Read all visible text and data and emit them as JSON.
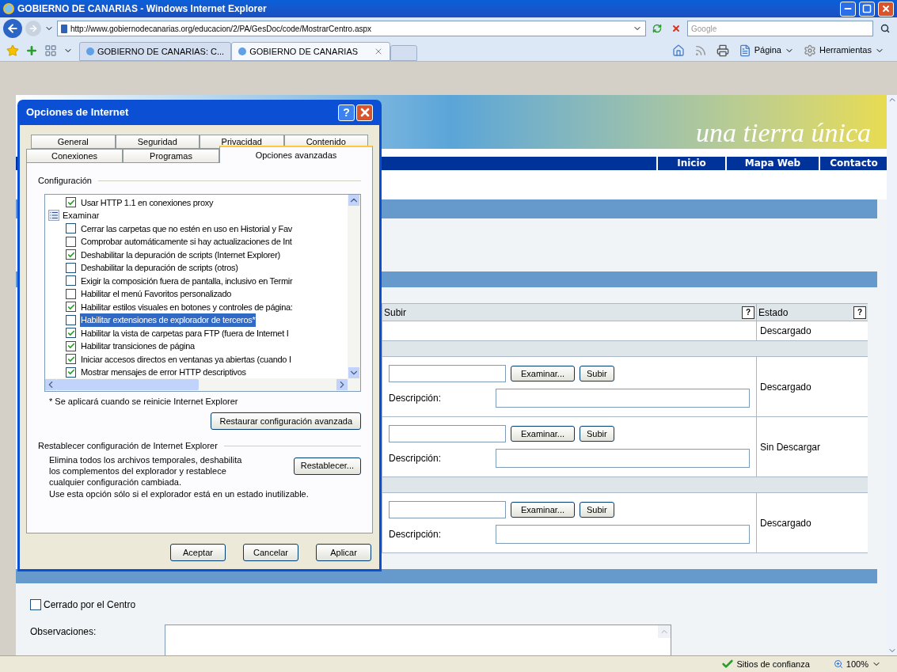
{
  "browser": {
    "title": "GOBIERNO DE CANARIAS - Windows Internet Explorer",
    "address": "http://www.gobiernodecanarias.org/educacion/2/PA/GesDoc/code/MostrarCentro.aspx",
    "search_placeholder": "Google",
    "tabs": [
      {
        "label": "GOBIERNO DE CANARIAS: C...",
        "selected": false
      },
      {
        "label": "GOBIERNO DE CANARIAS",
        "selected": true
      }
    ],
    "commands": [
      "Página",
      "Herramientas"
    ]
  },
  "page": {
    "banner_text": "una tierra única",
    "nav": [
      "Inicio",
      "Mapa Web",
      "Contacto"
    ],
    "table": {
      "columns": [
        {
          "label": "Subir",
          "help": "?"
        },
        {
          "label": "Estado",
          "help": "?"
        }
      ],
      "rows": [
        {
          "kind": "status",
          "estado": "Descargado"
        },
        {
          "kind": "separator"
        },
        {
          "kind": "upload",
          "browse": "Examinar...",
          "upload": "Subir",
          "description_label": "Descripción:",
          "estado": "Descargado"
        },
        {
          "kind": "upload",
          "browse": "Examinar...",
          "upload": "Subir",
          "description_label": "Descripción:",
          "estado": "Sin Descargar"
        },
        {
          "kind": "separator"
        },
        {
          "kind": "upload",
          "browse": "Examinar...",
          "upload": "Subir",
          "description_label": "Descripción:",
          "estado": "Descargado"
        }
      ]
    },
    "closed": {
      "label": "Cerrado por el Centro",
      "checked": false
    },
    "observations_label": "Observaciones:"
  },
  "dialog": {
    "title": "Opciones de Internet",
    "help": "?",
    "tab_rows": [
      [
        {
          "label": "General",
          "selected": false
        },
        {
          "label": "Seguridad",
          "selected": false
        },
        {
          "label": "Privacidad",
          "selected": false
        },
        {
          "label": "Contenido",
          "selected": false
        }
      ],
      [
        {
          "label": "Conexiones",
          "selected": false
        },
        {
          "label": "Programas",
          "selected": false
        },
        {
          "label": "Opciones avanzadas",
          "selected": true
        }
      ]
    ],
    "group_label": "Configuración",
    "options": [
      {
        "kind": "checkbox",
        "label": "Usar HTTP 1.1 en conexiones proxy",
        "checked": true,
        "selected": false
      },
      {
        "kind": "group",
        "label": "Examinar"
      },
      {
        "kind": "checkbox",
        "label": "Cerrar las carpetas que no estén en uso en Historial y Fav",
        "checked": false,
        "selected": false
      },
      {
        "kind": "checkbox",
        "label": "Comprobar automáticamente si hay actualizaciones de Int",
        "checked": false,
        "selected": false
      },
      {
        "kind": "checkbox",
        "label": "Deshabilitar la depuración de scripts (Internet Explorer)",
        "checked": true,
        "selected": false
      },
      {
        "kind": "checkbox",
        "label": "Deshabilitar la depuración de scripts (otros)",
        "checked": false,
        "selected": false
      },
      {
        "kind": "checkbox",
        "label": "Exigir la composición fuera de pantalla, inclusivo en Termir",
        "checked": false,
        "selected": false
      },
      {
        "kind": "checkbox",
        "label": "Habilitar el menú Favoritos personalizado",
        "checked": false,
        "selected": false
      },
      {
        "kind": "checkbox",
        "label": "Habilitar estilos visuales en botones y controles de página:",
        "checked": true,
        "selected": false
      },
      {
        "kind": "checkbox",
        "label": "Habilitar extensiones de explorador de terceros*",
        "checked": false,
        "selected": true
      },
      {
        "kind": "checkbox",
        "label": "Habilitar la vista de carpetas para FTP (fuera de Internet I",
        "checked": true,
        "selected": false
      },
      {
        "kind": "checkbox",
        "label": "Habilitar transiciones de página",
        "checked": true,
        "selected": false
      },
      {
        "kind": "checkbox",
        "label": "Iniciar accesos directos en ventanas ya abiertas (cuando I",
        "checked": true,
        "selected": false
      },
      {
        "kind": "checkbox",
        "label": "Mostrar mensajes de error HTTP descriptivos",
        "checked": true,
        "selected": false
      }
    ],
    "note": "* Se aplicará cuando se reinicie Internet Explorer",
    "restore_button": "Restaurar configuración avanzada",
    "reset_group_label": "Restablecer configuración de Internet Explorer",
    "reset_text": "Elimina todos los archivos temporales, deshabilita los complementos del explorador y restablece cualquier configuración cambiada.",
    "reset_hint": "Use esta opción sólo si el explorador está en un estado inutilizable.",
    "reset_button": "Restablecer...",
    "buttons": [
      "Aceptar",
      "Cancelar",
      "Aplicar"
    ]
  },
  "status_bar": {
    "zone": "Sitios de confianza",
    "zoom": "100%"
  }
}
